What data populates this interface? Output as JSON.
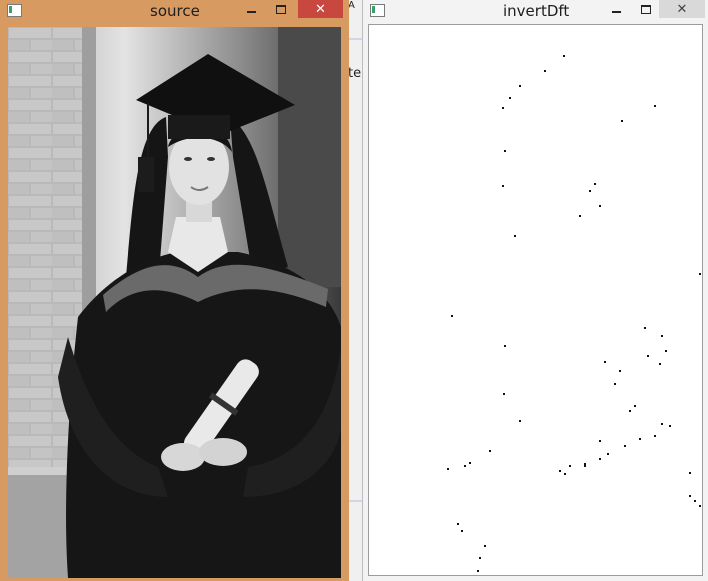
{
  "background_app": {
    "partial_letters": [
      "A",
      "te"
    ]
  },
  "source_window": {
    "title": "source",
    "controls": {
      "minimize": "minimize",
      "maximize": "maximize",
      "close": "✕"
    },
    "image": {
      "subject": "grayscale-graduate-portrait"
    }
  },
  "dft_window": {
    "title": "invertDft",
    "controls": {
      "minimize": "minimize",
      "maximize": "maximize",
      "close": "✕"
    },
    "image": {
      "content": "sparse-black-specks-on-white"
    }
  },
  "colors": {
    "source_frame": "#d79b62",
    "close_active": "#c8473e",
    "close_inactive": "#d9d9d9"
  }
}
